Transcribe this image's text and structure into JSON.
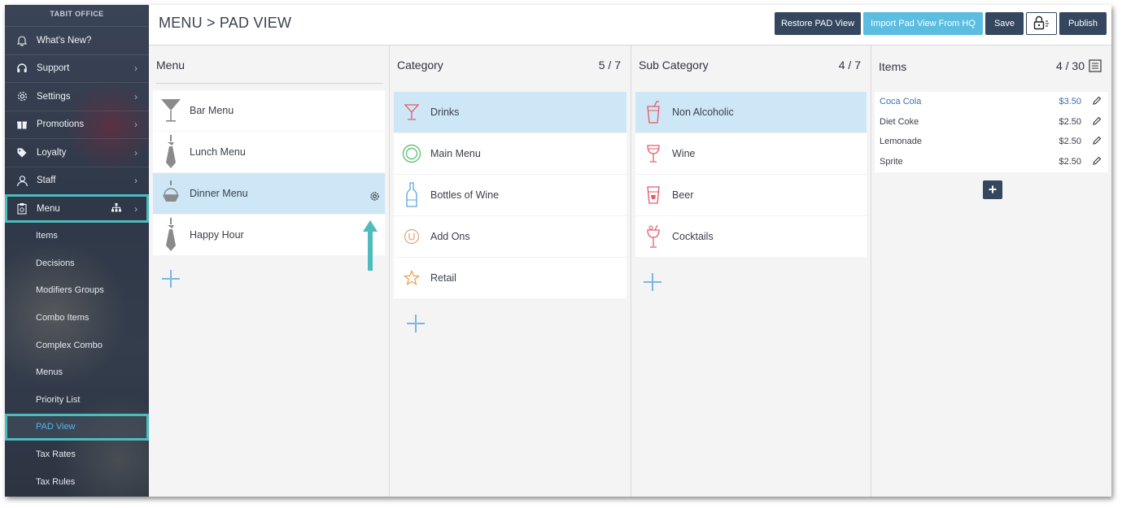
{
  "sidebar": {
    "brand": "TABIT OFFICE",
    "items": [
      {
        "label": "What's New?",
        "icon": "bell-icon"
      },
      {
        "label": "Support",
        "icon": "headset-icon"
      },
      {
        "label": "Settings",
        "icon": "gear-icon"
      },
      {
        "label": "Promotions",
        "icon": "gift-icon"
      },
      {
        "label": "Loyalty",
        "icon": "tag-icon"
      },
      {
        "label": "Staff",
        "icon": "person-icon"
      },
      {
        "label": "Menu",
        "icon": "clipboard-icon"
      }
    ],
    "submenu": [
      "Items",
      "Decisions",
      "Modifiers Groups",
      "Combo Items",
      "Complex Combo",
      "Menus",
      "Priority List",
      "PAD View",
      "Tax Rates",
      "Tax Rules"
    ],
    "active_submenu": "PAD View"
  },
  "header": {
    "breadcrumb": "MENU > PAD VIEW",
    "buttons": {
      "restore": "Restore PAD View",
      "import": "Import Pad View From HQ",
      "save": "Save",
      "publish": "Publish"
    }
  },
  "columns": {
    "menu": {
      "title": "Menu",
      "rows": [
        {
          "label": "Bar Menu",
          "icon": "martini-glass-icon"
        },
        {
          "label": "Lunch Menu",
          "icon": "tie-icon"
        },
        {
          "label": "Dinner Menu",
          "icon": "bowl-icon",
          "selected": true
        },
        {
          "label": "Happy Hour",
          "icon": "tie-icon"
        }
      ]
    },
    "category": {
      "title": "Category",
      "count": "5 / 7",
      "rows": [
        {
          "label": "Drinks",
          "icon": "cocktail-glass-icon",
          "selected": true
        },
        {
          "label": "Main Menu",
          "icon": "plate-icon"
        },
        {
          "label": "Bottles of Wine",
          "icon": "bottle-icon"
        },
        {
          "label": "Add Ons",
          "icon": "u-circle-icon"
        },
        {
          "label": "Retail",
          "icon": "star-icon"
        }
      ]
    },
    "subcategory": {
      "title": "Sub Category",
      "count": "4 / 7",
      "rows": [
        {
          "label": "Non Alcoholic",
          "icon": "soda-cup-icon",
          "selected": true
        },
        {
          "label": "Wine",
          "icon": "wine-glass-icon"
        },
        {
          "label": "Beer",
          "icon": "beer-glass-icon"
        },
        {
          "label": "Cocktails",
          "icon": "cocktail-icon"
        }
      ]
    },
    "items": {
      "title": "Items",
      "count": "4 / 30",
      "rows": [
        {
          "name": "Coca Cola",
          "price": "$3.50"
        },
        {
          "name": "Diet Coke",
          "price": "$2.50"
        },
        {
          "name": "Lemonade",
          "price": "$2.50"
        },
        {
          "name": "Sprite",
          "price": "$2.50"
        }
      ]
    }
  },
  "colors": {
    "sidebar_bg": "#2f3848",
    "highlight_outline": "#4cbcbd",
    "selected_row": "#cde7f7",
    "button_dark": "#34475f",
    "button_light": "#5bbde0",
    "link_blue": "#3b6fb0"
  }
}
